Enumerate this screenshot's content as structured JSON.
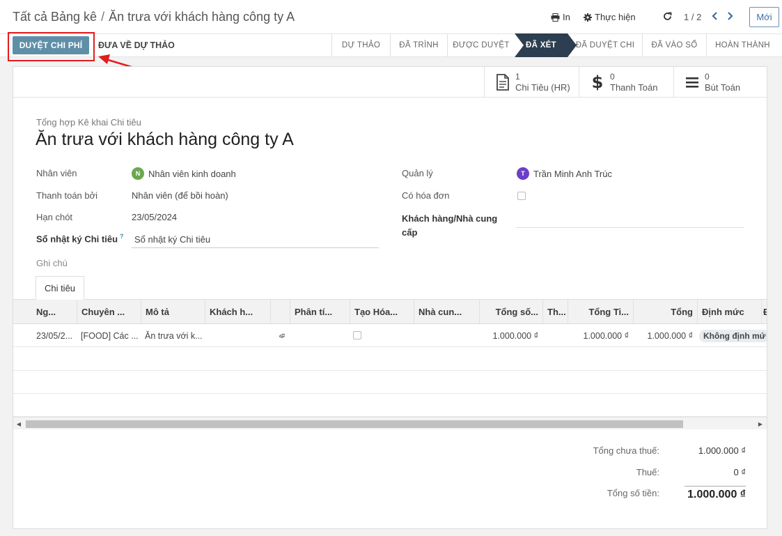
{
  "header": {
    "breadcrumb_parent": "Tất cả Bảng kê",
    "breadcrumb_sep": "/",
    "breadcrumb_current": "Ăn trưa với khách hàng công ty A",
    "print_label": "In",
    "action_label": "Thực hiện",
    "pager": "1 / 2",
    "new_label": "Mới"
  },
  "statusbar": {
    "approve_label": "DUYỆT CHI PHÍ",
    "reset_label": "ĐƯA VỀ DỰ THẢO",
    "stages": [
      "DỰ THẢO",
      "ĐÃ TRÌNH",
      "ĐƯỢC DUYỆT",
      "ĐÃ XÉT",
      "ĐÃ DUYỆT CHI",
      "ĐÃ VÀO SỔ",
      "HOÀN THÀNH"
    ],
    "active_stage": "ĐÃ XÉT"
  },
  "smart_buttons": [
    {
      "count": "1",
      "label": "Chi Tiêu (HR)",
      "icon": "document-icon"
    },
    {
      "count": "0",
      "label": "Thanh Toán",
      "icon": "dollar-icon"
    },
    {
      "count": "0",
      "label": "Bút Toán",
      "icon": "list-icon"
    }
  ],
  "form": {
    "subtitle": "Tổng hợp Kê khai Chi tiêu",
    "title": "Ăn trưa với khách hàng công ty A",
    "employee_label": "Nhân viên",
    "employee_value": "Nhân viên kinh doanh",
    "employee_avatar": "N",
    "paid_by_label": "Thanh toán bởi",
    "paid_by_value": "Nhân viên (để bồi hoàn)",
    "deadline_label": "Hạn chót",
    "deadline_value": "23/05/2024",
    "journal_label": "Sổ nhật ký Chi tiêu",
    "journal_help": "?",
    "journal_value": "Sổ nhật ký Chi tiêu",
    "manager_label": "Quản lý",
    "manager_value": "Trần Minh Anh Trúc",
    "manager_avatar": "T",
    "invoice_label": "Có hóa đơn",
    "vendor_label_1": "Khách hàng/Nhà cung",
    "vendor_label_2": "cấp",
    "notes_label": "Ghi chú"
  },
  "colors": {
    "employee_avatar": "#6aa84f",
    "manager_avatar": "#6b3fc7",
    "active_stage": "#2c3e50",
    "primary_button": "#5f8fa8",
    "highlight": "#e21d1d"
  },
  "tab_label": "Chi tiêu",
  "table": {
    "columns": [
      "Ng...",
      "Chuyên ...",
      "Mô tả",
      "Khách h...",
      "",
      "Phân tí...",
      "Tạo Hóa...",
      "Nhà cun...",
      "Tổng số...",
      "Th...",
      "Tổng Ti...",
      "Tổng",
      "Định mức",
      "Đ"
    ],
    "rows": [
      {
        "date": "23/05/2...",
        "category": "[FOOD] Các ...",
        "description": "Ăn trưa với k...",
        "customer": "",
        "analytic": "",
        "vendor": "",
        "total_qty": "1.000.000 ₫",
        "tax": "",
        "total_amount": "1.000.000 ₫",
        "total": "1.000.000 ₫",
        "norm": "Không định mứ"
      }
    ]
  },
  "totals": {
    "untaxed_label": "Tổng chưa thuế:",
    "untaxed_value": "1.000.000 ₫",
    "tax_label": "Thuế:",
    "tax_value": "0 ₫",
    "total_label": "Tổng số tiền:",
    "total_value": "1.000.000 ₫"
  }
}
